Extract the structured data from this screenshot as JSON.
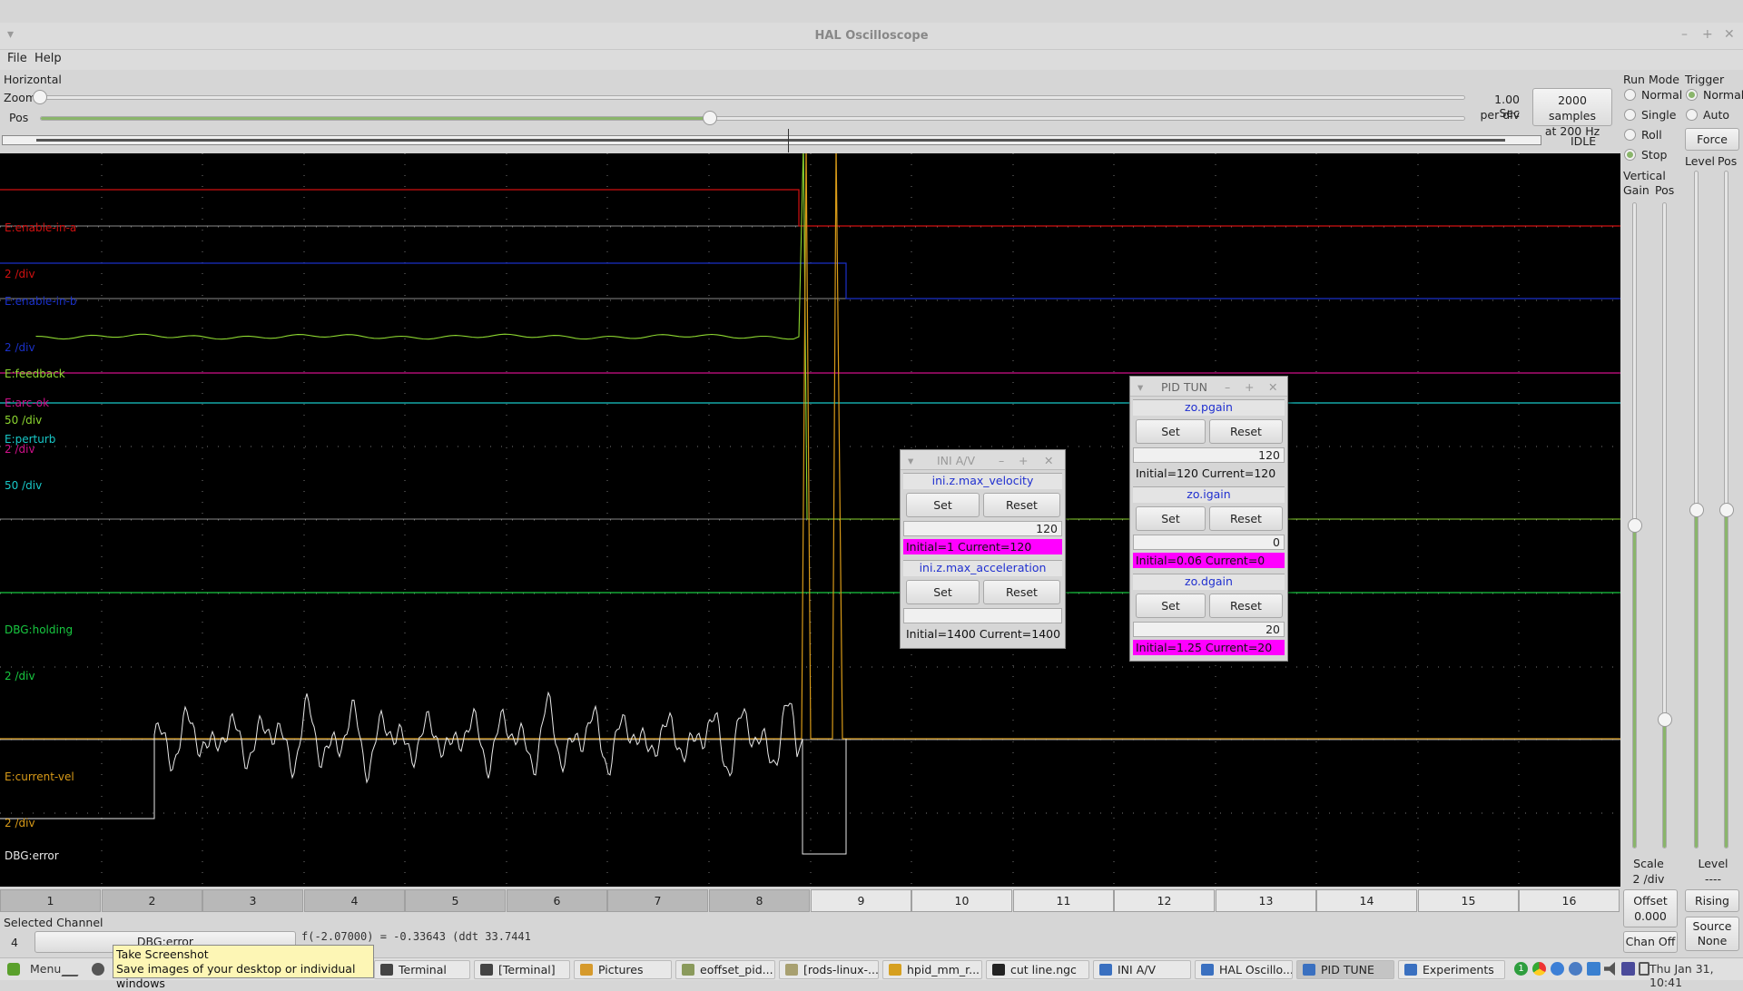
{
  "window": {
    "title": "HAL Oscilloscope",
    "controls": [
      "–",
      "+",
      "✕"
    ]
  },
  "menu": {
    "file": "File",
    "help": "Help"
  },
  "horizontal": {
    "section_label": "Horizontal",
    "zoom_label": "Zoom",
    "pos_label": "Pos",
    "zoom_fraction": 0.0,
    "pos_fraction": 0.47,
    "timebase_line1": "1.00 Sec",
    "timebase_line2": "per div",
    "samples_line1": "2000 samples",
    "samples_line2": "at 200 Hz",
    "status": "IDLE"
  },
  "run_mode": {
    "label": "Run Mode",
    "options": [
      "Normal",
      "Single",
      "Roll",
      "Stop"
    ],
    "selected": "Stop"
  },
  "trigger": {
    "label": "Trigger",
    "options": [
      "Normal",
      "Auto"
    ],
    "selected": "Normal",
    "force_label": "Force",
    "level_label": "Level",
    "pos_label": "Pos",
    "level_fraction": 0.5,
    "pos_fraction": 0.5,
    "level_caption": "Level",
    "level_value": "----",
    "edge_button": "Rising",
    "source_line1": "Source",
    "source_line2": "None"
  },
  "vertical": {
    "label": "Vertical",
    "gain_label": "Gain",
    "pos_label": "Pos",
    "gain_fraction": 0.5,
    "pos_fraction": 0.2,
    "scale_label": "Scale",
    "scale_value": "2 /div",
    "offset_label": "Offset",
    "offset_value": "0.000",
    "chan_off_label": "Chan Off"
  },
  "channels": [
    {
      "name": "E:enable-in-a",
      "scale": "2 /div",
      "color": "#d01010"
    },
    {
      "name": "E:enable-in-b",
      "scale": "2 /div",
      "color": "#1a30c8"
    },
    {
      "name": "E:feedback",
      "scale": "50 /div",
      "color": "#8cd630"
    },
    {
      "name": "E:arc-ok",
      "scale": "2 /div",
      "color": "#d0108a"
    },
    {
      "name": "E:perturb",
      "scale": "50 /div",
      "color": "#18c8c8"
    },
    {
      "name": "DBG:holding",
      "scale": "2 /div",
      "color": "#18c840"
    },
    {
      "name": "E:current-vel",
      "scale": "2 /div",
      "color": "#d89a18"
    },
    {
      "name": "DBG:error",
      "scale": "2 /div",
      "color": "#e8e8e8"
    }
  ],
  "tabs": [
    "1",
    "2",
    "3",
    "4",
    "5",
    "6",
    "7",
    "8",
    "9",
    "10",
    "11",
    "12",
    "13",
    "14",
    "15",
    "16"
  ],
  "selected_channel": {
    "label": "Selected Channel",
    "number": "4",
    "name": "DBG:error",
    "readout": "f(-2.07000) = -0.33643 (ddt  33.7441"
  },
  "ini_window": {
    "title": "INI A/V",
    "params": [
      {
        "name": "ini.z.max_velocity",
        "value": "120",
        "status": "Initial=1 Current=120",
        "changed": true
      },
      {
        "name": "ini.z.max_acceleration",
        "value": "",
        "status": "Initial=1400 Current=1400",
        "changed": false
      }
    ],
    "set_label": "Set",
    "reset_label": "Reset"
  },
  "pid_window": {
    "title": "PID TUN",
    "params": [
      {
        "name": "zo.pgain",
        "value": "120",
        "status": "Initial=120 Current=120",
        "changed": false
      },
      {
        "name": "zo.igain",
        "value": "0",
        "status": "Initial=0.06 Current=0",
        "changed": true
      },
      {
        "name": "zo.dgain",
        "value": "20",
        "status": "Initial=1.25 Current=20",
        "changed": true
      }
    ],
    "set_label": "Set",
    "reset_label": "Reset"
  },
  "taskbar": {
    "menu_label": "Menu",
    "tasks": [
      {
        "label": "Terminal",
        "active": false
      },
      {
        "label": "[Terminal]",
        "active": false
      },
      {
        "label": "Pictures",
        "active": false
      },
      {
        "label": "eoffset_pid...",
        "active": false
      },
      {
        "label": "[rods-linux-...",
        "active": false
      },
      {
        "label": "hpid_mm_r...",
        "active": false
      },
      {
        "label": "cut line.ngc",
        "active": false
      },
      {
        "label": "INI A/V",
        "active": false
      },
      {
        "label": "HAL Oscillo...",
        "active": false
      },
      {
        "label": "PID TUNE",
        "active": true
      },
      {
        "label": "Experiments",
        "active": false
      }
    ],
    "clock": "Thu Jan 31, 10:41"
  },
  "tooltip": {
    "title": "Take Screenshot",
    "body": "Save images of your desktop or individual windows"
  }
}
